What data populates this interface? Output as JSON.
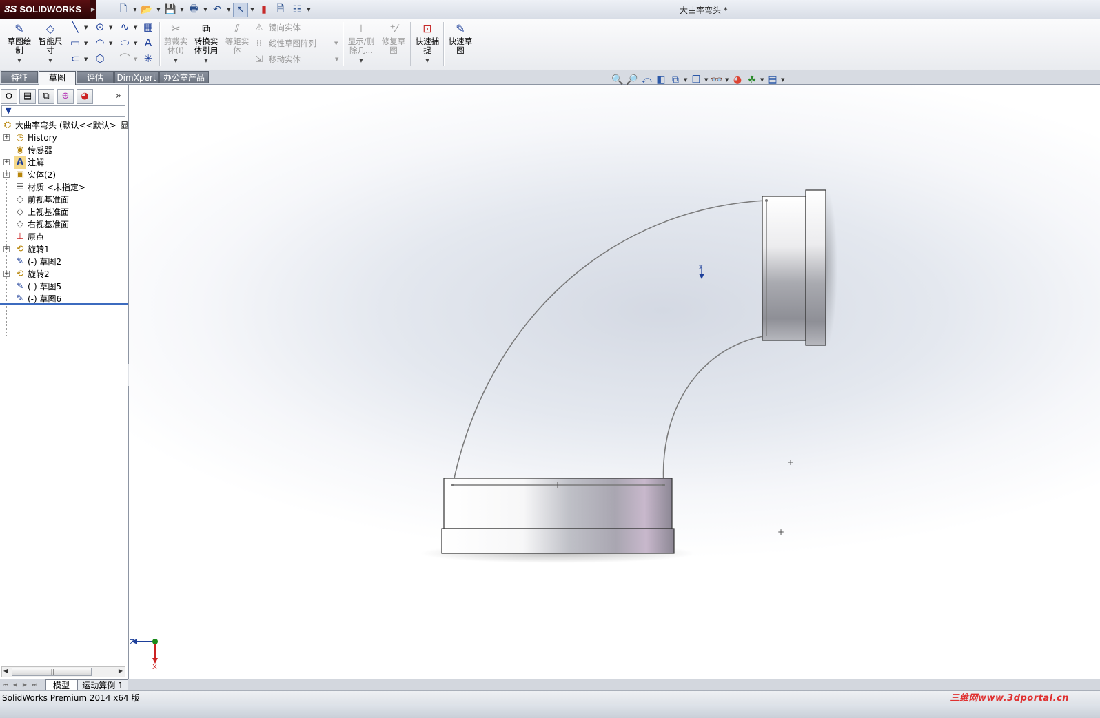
{
  "window": {
    "logo_text": "SOLIDWORKS",
    "logo_prefix": "3S",
    "document_title": "大曲率弯头 *"
  },
  "quick_access": {
    "icons": [
      "new-document-icon",
      "open-icon",
      "save-icon",
      "print-icon",
      "undo-icon",
      "select-icon",
      "rebuild-icon",
      "file-properties-icon",
      "options-icon"
    ]
  },
  "command_manager": {
    "sketch": "草图绘\n制",
    "smart_dimension": "智能尺\n寸",
    "trim_entities": "剪裁实\n体(I)",
    "convert_entities": "转换实\n体引用",
    "offset_entities": "等距实\n体",
    "mirror_entities": "镜向实体",
    "linear_sketch_pattern": "线性草图阵列",
    "move_entities": "移动实体",
    "display_delete_relations": "显示/删\n除几...",
    "repair_sketch": "修复草\n图",
    "quick_snaps": "快速捕\n捉",
    "rapid_sketch": "快速草\n图"
  },
  "tabs": [
    {
      "label": "特征"
    },
    {
      "label": "草图"
    },
    {
      "label": "评估"
    },
    {
      "label": "DimXpert"
    },
    {
      "label": "办公室产品"
    }
  ],
  "feature_tree": {
    "root": "大曲率弯头 (默认<<默认>_显",
    "items": [
      {
        "label": "History",
        "icon": "history-icon",
        "expandable": true
      },
      {
        "label": "传感器",
        "icon": "sensor-icon",
        "expandable": false
      },
      {
        "label": "注解",
        "icon": "annotation-icon",
        "expandable": true
      },
      {
        "label": "实体(2)",
        "icon": "solid-bodies-icon",
        "expandable": true
      },
      {
        "label": "材质 <未指定>",
        "icon": "material-icon",
        "expandable": false
      },
      {
        "label": "前视基准面",
        "icon": "plane-icon",
        "expandable": false
      },
      {
        "label": "上视基准面",
        "icon": "plane-icon",
        "expandable": false
      },
      {
        "label": "右视基准面",
        "icon": "plane-icon",
        "expandable": false
      },
      {
        "label": "原点",
        "icon": "origin-icon",
        "expandable": false
      },
      {
        "label": "旋转1",
        "icon": "revolve-icon",
        "expandable": true
      },
      {
        "label": "(-) 草图2",
        "icon": "sketch-icon",
        "expandable": false
      },
      {
        "label": "旋转2",
        "icon": "revolve-icon",
        "expandable": true
      },
      {
        "label": "(-) 草图5",
        "icon": "sketch-icon",
        "expandable": false
      },
      {
        "label": "(-) 草图6",
        "icon": "sketch-icon",
        "expandable": false
      }
    ]
  },
  "bottom_tabs": [
    {
      "label": "模型"
    },
    {
      "label": "运动算例 1"
    }
  ],
  "triad": {
    "z_label": "Z",
    "x_label": "X"
  },
  "status": {
    "product": "SolidWorks Premium 2014 x64 版",
    "watermark": "三维网www.3dportal.cn"
  },
  "colors": {
    "logo_bg": "#4a0c0e",
    "active_tab": "#f5f6f8",
    "inactive_tab": "#7a818d",
    "rollback_bar": "#3c6bbf",
    "sketch_curve": "#7a7a7a"
  }
}
